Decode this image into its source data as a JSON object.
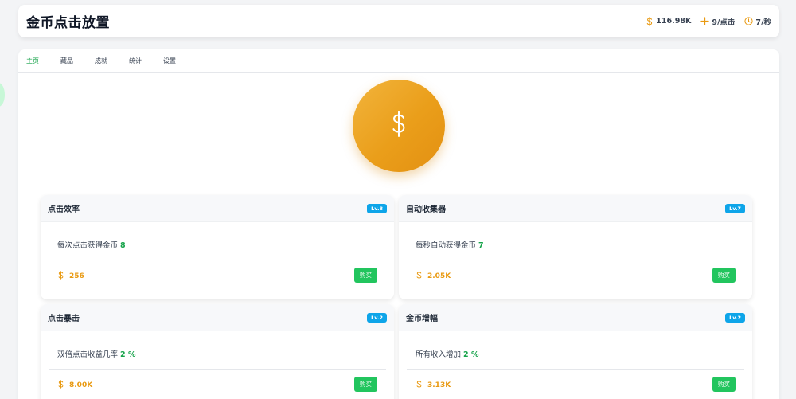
{
  "app": {
    "title": "金币点击放置"
  },
  "header_stats": {
    "coins": "116.98K",
    "per_click": "9/点击",
    "per_second": "7/秒"
  },
  "tabs": [
    {
      "label": "主页",
      "active": true
    },
    {
      "label": "藏品",
      "active": false
    },
    {
      "label": "成就",
      "active": false
    },
    {
      "label": "统计",
      "active": false
    },
    {
      "label": "设置",
      "active": false
    }
  ],
  "upgrades": [
    {
      "title": "点击效率",
      "level": "Lv.8",
      "desc": "每次点击获得金币",
      "value": "8",
      "cost": "256",
      "buy_label": "购买"
    },
    {
      "title": "自动收集器",
      "level": "Lv.7",
      "desc": "每秒自动获得金币",
      "value": "7",
      "cost": "2.05K",
      "buy_label": "购买"
    },
    {
      "title": "点击暴击",
      "level": "Lv.2",
      "desc": "双倍点击收益几率",
      "value": "2 %",
      "cost": "8.00K",
      "buy_label": "购买"
    },
    {
      "title": "金币增幅",
      "level": "Lv.2",
      "desc": "所有收入增加",
      "value": "2 %",
      "cost": "3.13K",
      "buy_label": "购买"
    }
  ],
  "colors": {
    "accent_green": "#22c55e",
    "gold": "#e99a12",
    "badge_blue": "#0ea5e9"
  },
  "icons": {
    "coins": "dollar-icon",
    "per_click": "plus-icon",
    "per_second": "clock-icon",
    "coin_button": "dollar-icon"
  }
}
